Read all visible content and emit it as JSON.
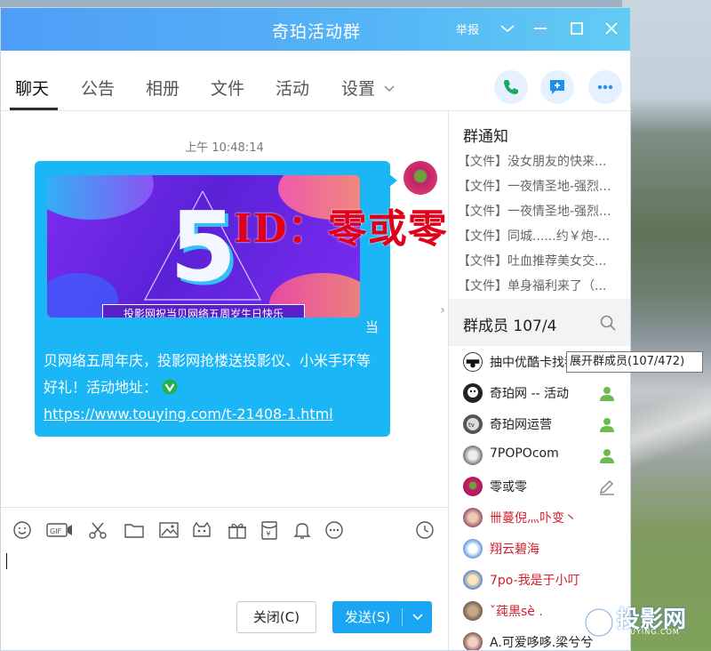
{
  "window": {
    "title": "奇珀活动群",
    "report_label": "举报"
  },
  "tabs": [
    {
      "label": "聊天",
      "active": true
    },
    {
      "label": "公告"
    },
    {
      "label": "相册"
    },
    {
      "label": "文件"
    },
    {
      "label": "活动"
    },
    {
      "label": "设置"
    }
  ],
  "chat": {
    "timestamp": "上午 10:48:14",
    "banner_caption": "投影网祝当贝网络五周岁生日快乐",
    "bubble_suffix": "当",
    "message_text": "贝网络五周年庆，投影网抢楼送投影仪、小米手环等好礼！活动地址：",
    "message_link": "https://www.touying.com/t-21408-1.html",
    "watermark": "ID：零或零"
  },
  "toolbar": {
    "icons": [
      "emoji-icon",
      "gif-icon",
      "scissors-icon",
      "folder-icon",
      "image-icon",
      "game-icon",
      "gift-icon",
      "red-envelope-icon",
      "bell-icon",
      "more-icon",
      "history-icon"
    ]
  },
  "composer": {
    "close_label": "关闭(C)",
    "send_label": "发送(S)"
  },
  "notices": {
    "title": "群通知",
    "items": [
      "【文件】没女朋友的快来...",
      "【文件】一夜情圣地-强烈...",
      "【文件】一夜情圣地-强烈...",
      "【文件】同城......约￥炮-...",
      "【文件】吐血推荐美女交...",
      "【文件】单身福利来了（..."
    ]
  },
  "members": {
    "title": "群成员 107/4",
    "tooltip": "展开群成员(107/472)",
    "list": [
      {
        "name": "抽中优酷卡找我",
        "role": "admin",
        "red": false
      },
      {
        "name": "奇珀网 -- 活动",
        "role": "admin",
        "red": false
      },
      {
        "name": "奇珀网运营",
        "role": "admin",
        "red": false
      },
      {
        "name": "7POPOcom",
        "role": "admin",
        "red": false
      },
      {
        "name": "零或零",
        "role": "edit",
        "red": false
      },
      {
        "name": "卌蔓倪灬卟变丶",
        "role": "",
        "red": true
      },
      {
        "name": "翔云碧海",
        "role": "",
        "red": true
      },
      {
        "name": "7po-我是于小叮",
        "role": "",
        "red": true
      },
      {
        "name": "ˇ莼黒sè .",
        "role": "",
        "red": true
      },
      {
        "name": "A.可爱哆哆.梁兮兮",
        "role": "",
        "red": false
      }
    ]
  },
  "brand": {
    "name": "投影网",
    "sub": "TOUYING.COM"
  },
  "colors": {
    "title_bar": "#55b5f6",
    "bubble": "#1bb6f5",
    "send_button": "#1ba6f3",
    "watermark": "#e0001b"
  }
}
